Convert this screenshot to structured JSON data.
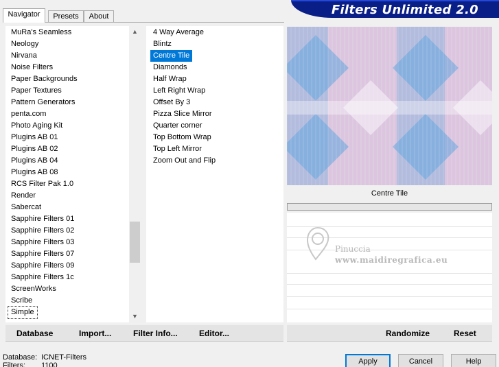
{
  "tabs": [
    {
      "label": "Navigator"
    },
    {
      "label": "Presets"
    },
    {
      "label": "About"
    }
  ],
  "banner": {
    "title": "Filters Unlimited 2.0"
  },
  "categories": [
    "MuRa's Seamless",
    "Neology",
    "Nirvana",
    "Noise Filters",
    "Paper Backgrounds",
    "Paper Textures",
    "Pattern Generators",
    "penta.com",
    "Photo Aging Kit",
    "Plugins AB 01",
    "Plugins AB 02",
    "Plugins AB 04",
    "Plugins AB 08",
    "RCS Filter Pak 1.0",
    "Render",
    "Sabercat",
    "Sapphire Filters 01",
    "Sapphire Filters 02",
    "Sapphire Filters 03",
    "Sapphire Filters 07",
    "Sapphire Filters 09",
    "Sapphire Filters 1c",
    "ScreenWorks",
    "Scribe",
    "Simple"
  ],
  "selected_category": "Simple",
  "filters": [
    "4 Way Average",
    "Blintz",
    "Centre Tile",
    "Diamonds",
    "Half Wrap",
    "Left Right Wrap",
    "Offset By 3",
    "Pizza Slice Mirror",
    "Quarter corner",
    "Top Bottom Wrap",
    "Top Left Mirror",
    "Zoom Out and Flip"
  ],
  "selected_filter": "Centre Tile",
  "preview": {
    "caption": "Centre Tile"
  },
  "watermark": {
    "name": "Pinuccia",
    "url": "www.maidiregrafica.eu"
  },
  "left_buttons": {
    "database": "Database",
    "import": "Import...",
    "filter_info": "Filter Info...",
    "editor": "Editor..."
  },
  "right_buttons": {
    "randomize": "Randomize",
    "reset": "Reset"
  },
  "status": {
    "database_label": "Database:",
    "database_value": "ICNET-Filters",
    "filters_label": "Filters:",
    "filters_value": "1100"
  },
  "dialog_buttons": {
    "apply": "Apply",
    "cancel": "Cancel",
    "help": "Help"
  },
  "colors": {
    "banner": "#0a1e87",
    "selection": "#0078d7",
    "preview_blue": "#6aa8de",
    "preview_pink": "#dcc6df"
  }
}
